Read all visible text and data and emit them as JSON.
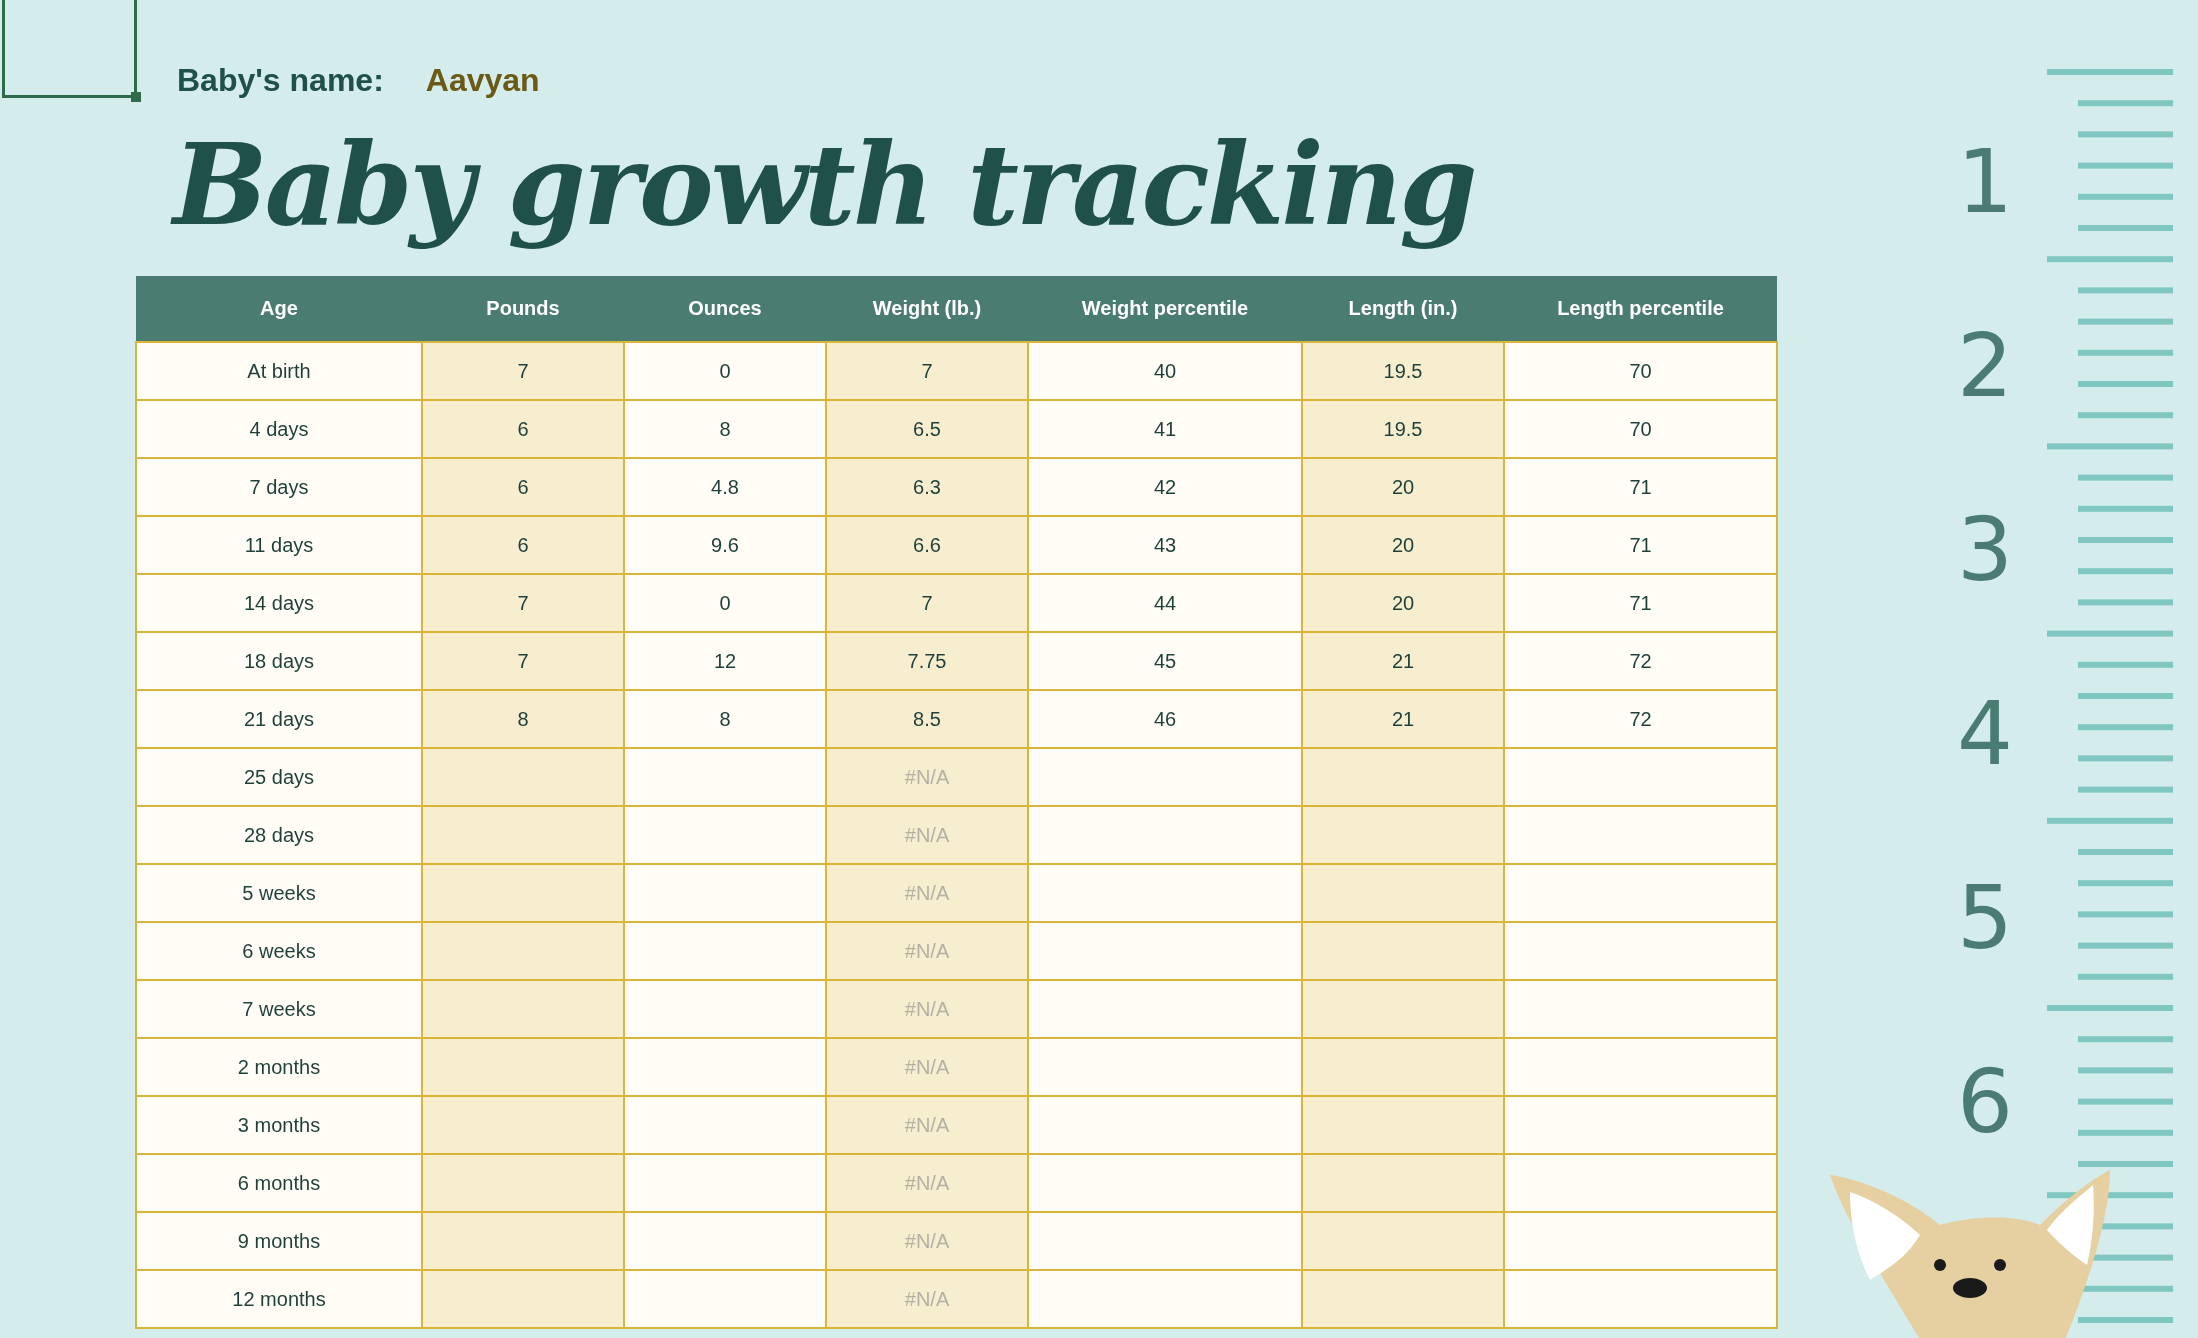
{
  "name_label": "Baby's name:",
  "name_value": "Aavyan",
  "title": "Baby growth tracking",
  "columns": [
    {
      "label": "Age",
      "shaded": false
    },
    {
      "label": "Pounds",
      "shaded": true
    },
    {
      "label": "Ounces",
      "shaded": false
    },
    {
      "label": "Weight (lb.)",
      "shaded": true
    },
    {
      "label": "Weight percentile",
      "shaded": false
    },
    {
      "label": "Length (in.)",
      "shaded": true
    },
    {
      "label": "Length percentile",
      "shaded": false
    }
  ],
  "rows": [
    {
      "age": "At birth",
      "pounds": "7",
      "ounces": "0",
      "weight": "7",
      "weight_na": false,
      "weight_percentile": "40",
      "length": "19.5",
      "length_percentile": "70"
    },
    {
      "age": "4 days",
      "pounds": "6",
      "ounces": "8",
      "weight": "6.5",
      "weight_na": false,
      "weight_percentile": "41",
      "length": "19.5",
      "length_percentile": "70"
    },
    {
      "age": "7 days",
      "pounds": "6",
      "ounces": "4.8",
      "weight": "6.3",
      "weight_na": false,
      "weight_percentile": "42",
      "length": "20",
      "length_percentile": "71"
    },
    {
      "age": "11 days",
      "pounds": "6",
      "ounces": "9.6",
      "weight": "6.6",
      "weight_na": false,
      "weight_percentile": "43",
      "length": "20",
      "length_percentile": "71"
    },
    {
      "age": "14 days",
      "pounds": "7",
      "ounces": "0",
      "weight": "7",
      "weight_na": false,
      "weight_percentile": "44",
      "length": "20",
      "length_percentile": "71"
    },
    {
      "age": "18 days",
      "pounds": "7",
      "ounces": "12",
      "weight": "7.75",
      "weight_na": false,
      "weight_percentile": "45",
      "length": "21",
      "length_percentile": "72"
    },
    {
      "age": "21 days",
      "pounds": "8",
      "ounces": "8",
      "weight": "8.5",
      "weight_na": false,
      "weight_percentile": "46",
      "length": "21",
      "length_percentile": "72"
    },
    {
      "age": "25 days",
      "weight": "#N/A",
      "weight_na": true
    },
    {
      "age": "28 days",
      "weight": "#N/A",
      "weight_na": true
    },
    {
      "age": "5 weeks",
      "weight": "#N/A",
      "weight_na": true
    },
    {
      "age": "6 weeks",
      "weight": "#N/A",
      "weight_na": true
    },
    {
      "age": "7 weeks",
      "weight": "#N/A",
      "weight_na": true
    },
    {
      "age": "2 months",
      "weight": "#N/A",
      "weight_na": true
    },
    {
      "age": "3 months",
      "weight": "#N/A",
      "weight_na": true
    },
    {
      "age": "6 months",
      "weight": "#N/A",
      "weight_na": true
    },
    {
      "age": "9 months",
      "weight": "#N/A",
      "weight_na": true
    },
    {
      "age": "12 months",
      "weight": "#N/A",
      "weight_na": true
    }
  ],
  "ruler_numbers": [
    "1",
    "2",
    "3",
    "4",
    "5",
    "6"
  ]
}
